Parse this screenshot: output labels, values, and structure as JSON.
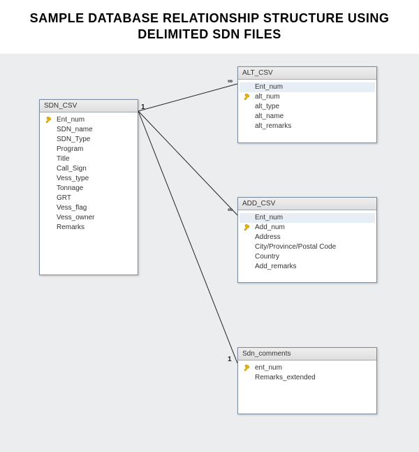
{
  "title": "SAMPLE DATABASE RELATIONSHIP STRUCTURE USING DELIMITED SDN FILES",
  "tables": {
    "sdn": {
      "name": "SDN_CSV",
      "fields": [
        {
          "key": true,
          "name": "Ent_num"
        },
        {
          "key": false,
          "name": "SDN_name"
        },
        {
          "key": false,
          "name": "SDN_Type"
        },
        {
          "key": false,
          "name": "Program"
        },
        {
          "key": false,
          "name": "Title"
        },
        {
          "key": false,
          "name": "Call_Sign"
        },
        {
          "key": false,
          "name": "Vess_type"
        },
        {
          "key": false,
          "name": "Tonnage"
        },
        {
          "key": false,
          "name": "GRT"
        },
        {
          "key": false,
          "name": "Vess_flag"
        },
        {
          "key": false,
          "name": "Vess_owner"
        },
        {
          "key": false,
          "name": "Remarks"
        }
      ]
    },
    "alt": {
      "name": "ALT_CSV",
      "fields": [
        {
          "key": false,
          "name": "Ent_num",
          "hl": true
        },
        {
          "key": true,
          "name": "alt_num"
        },
        {
          "key": false,
          "name": "alt_type"
        },
        {
          "key": false,
          "name": "alt_name"
        },
        {
          "key": false,
          "name": "alt_remarks"
        }
      ]
    },
    "add": {
      "name": "ADD_CSV",
      "fields": [
        {
          "key": false,
          "name": "Ent_num",
          "hl": true
        },
        {
          "key": true,
          "name": "Add_num"
        },
        {
          "key": false,
          "name": "Address"
        },
        {
          "key": false,
          "name": "City/Province/Postal Code"
        },
        {
          "key": false,
          "name": "Country"
        },
        {
          "key": false,
          "name": "Add_remarks"
        }
      ]
    },
    "cmt": {
      "name": "Sdn_comments",
      "fields": [
        {
          "key": true,
          "name": "ent_num"
        },
        {
          "key": false,
          "name": "Remarks_extended"
        }
      ]
    }
  },
  "rel": {
    "one1": "1",
    "inf1": "∞",
    "inf2": "∞",
    "one2": "1"
  }
}
